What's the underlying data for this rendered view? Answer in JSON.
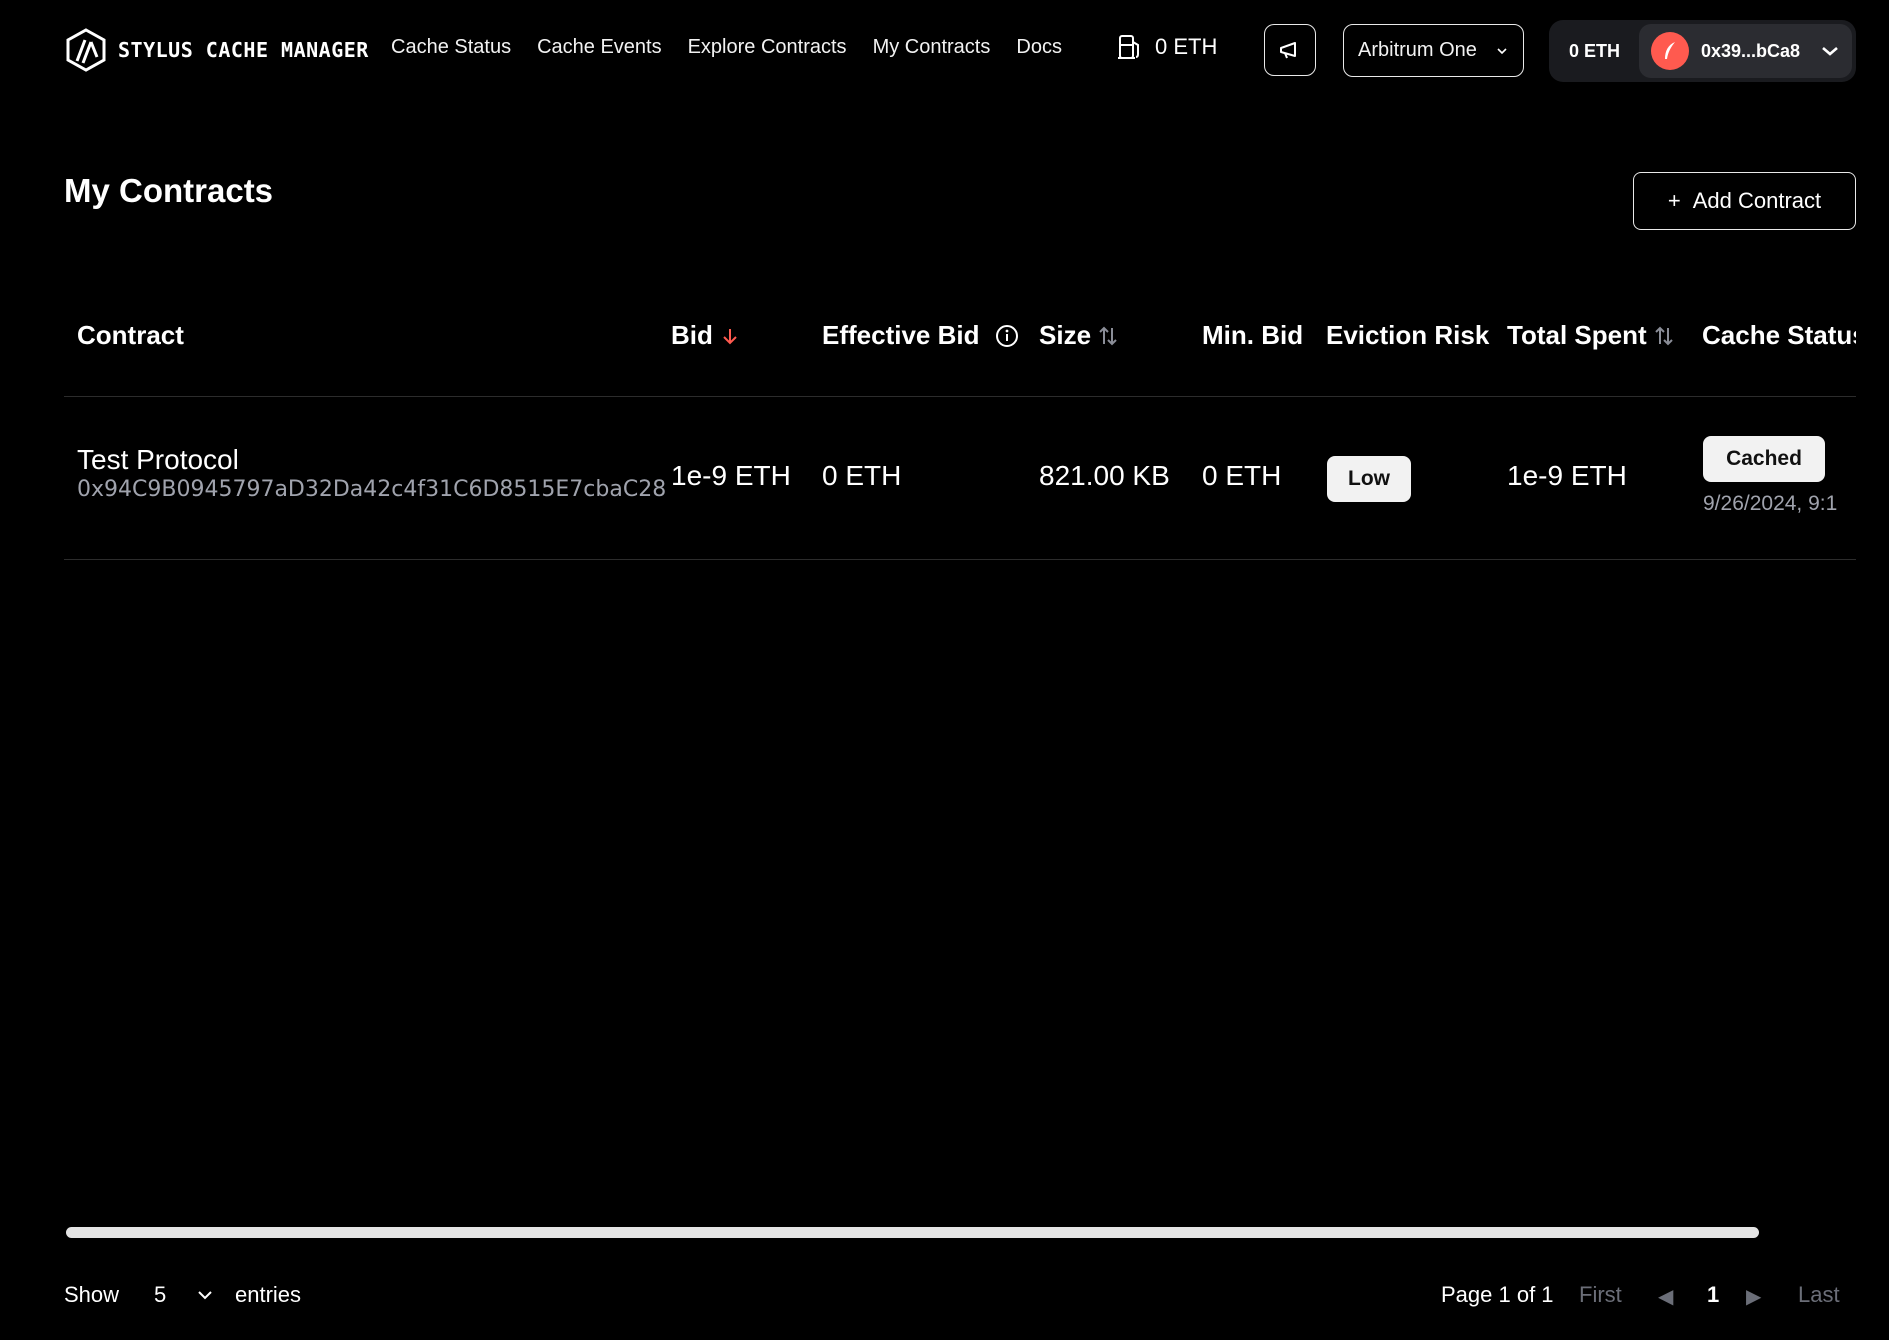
{
  "app": {
    "name": "STYLUS CACHE MANAGER"
  },
  "nav": {
    "links": [
      "Cache Status",
      "Cache Events",
      "Explore Contracts",
      "My Contracts",
      "Docs"
    ]
  },
  "gas": {
    "value": "0 ETH"
  },
  "network": {
    "selected": "Arbitrum One"
  },
  "wallet": {
    "balance": "0 ETH",
    "address": "0x39...bCa8"
  },
  "page": {
    "title": "My Contracts",
    "add_button": "Add Contract",
    "add_icon": "+"
  },
  "table": {
    "headers": {
      "contract": "Contract",
      "bid": "Bid",
      "effective_bid": "Effective Bid",
      "size": "Size",
      "min_bid": "Min. Bid",
      "eviction_risk": "Eviction Risk",
      "total_spent": "Total Spent",
      "cache_status": "Cache Status"
    },
    "rows": [
      {
        "name": "Test Protocol",
        "address": "0x94C9B0945797aD32Da42c4f31C6D8515E7cbaC28",
        "bid": "1e-9 ETH",
        "effective_bid": "0 ETH",
        "size": "821.00 KB",
        "min_bid": "0 ETH",
        "eviction_risk": "Low",
        "total_spent": "1e-9 ETH",
        "cache_status": "Cached",
        "cache_date": "9/26/2024, 9:1"
      }
    ]
  },
  "pagination": {
    "show_label": "Show",
    "page_size": "5",
    "entries_label": "entries",
    "page_info": "Page 1 of 1",
    "first": "First",
    "prev": "◀",
    "current": "1",
    "next": "▶",
    "last": "Last"
  },
  "colors": {
    "background": "#000000",
    "sort_active": "#ff5a4f",
    "muted": "#a0a3ad",
    "avatar": "#ff5a4f"
  },
  "icons": [
    "arbitrum-logo-icon",
    "gas-pump-icon",
    "megaphone-icon",
    "chevron-down-icon",
    "sort-arrow-down-icon",
    "info-icon",
    "sort-arrows-icon"
  ]
}
